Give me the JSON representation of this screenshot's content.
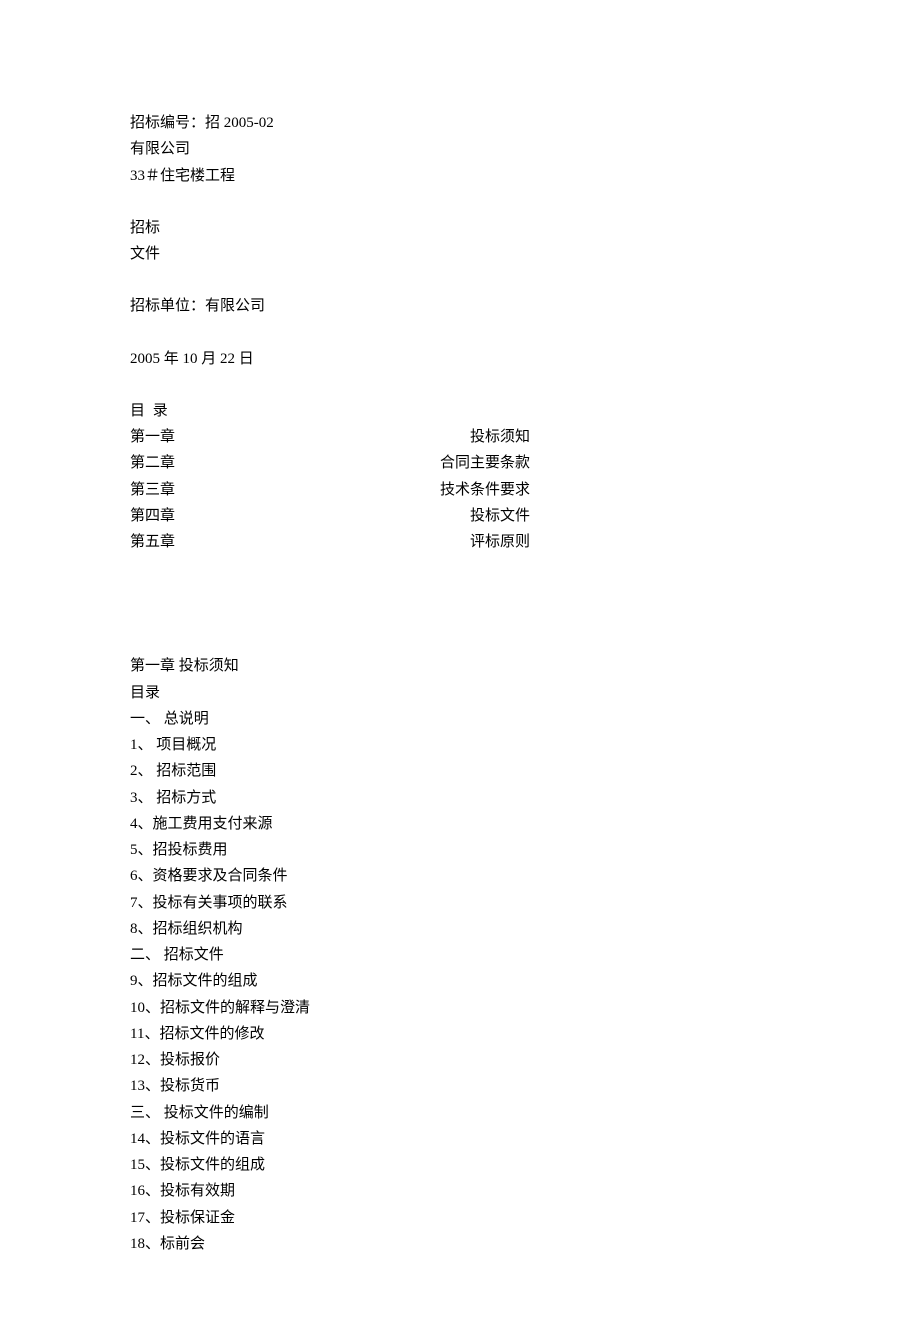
{
  "header": {
    "bid_number_prefix": "招标编号：招 ",
    "bid_number_value": "2005-02",
    "company": "有限公司",
    "project": "33＃住宅楼工程",
    "title_line_1": "招标",
    "title_line_2": "文件",
    "bid_unit_label": "招标单位：",
    "bid_unit_value": "有限公司",
    "date_year": "2005",
    "date_year_suffix": " 年 ",
    "date_month": "10",
    "date_month_suffix": " 月 ",
    "date_day": "22",
    "date_day_suffix": " 日"
  },
  "toc": {
    "title": "目  录",
    "rows": [
      {
        "chapter": "第一章",
        "label": " 投标须知"
      },
      {
        "chapter": "第二章",
        "label": "合同主要条款"
      },
      {
        "chapter": "第三章",
        "label": "技术条件要求"
      },
      {
        "chapter": "第四章",
        "label": "投标文件"
      },
      {
        "chapter": "第五章",
        "label": "评标原则"
      }
    ]
  },
  "chapter1": {
    "heading": "第一章  投标须知",
    "subheading": "目录",
    "items": [
      "一、    总说明",
      "1、 项目概况",
      "2、 招标范围",
      "3、 招标方式",
      "4、施工费用支付来源",
      "5、招投标费用",
      "6、资格要求及合同条件",
      "7、投标有关事项的联系",
      "8、招标组织机构",
      "二、    招标文件",
      "9、招标文件的组成",
      "10、招标文件的解释与澄清",
      "11、招标文件的修改",
      "12、投标报价",
      "13、投标货币",
      "三、    投标文件的编制",
      "14、投标文件的语言",
      "15、投标文件的组成",
      "16、投标有效期",
      "17、投标保证金",
      "18、标前会"
    ]
  }
}
